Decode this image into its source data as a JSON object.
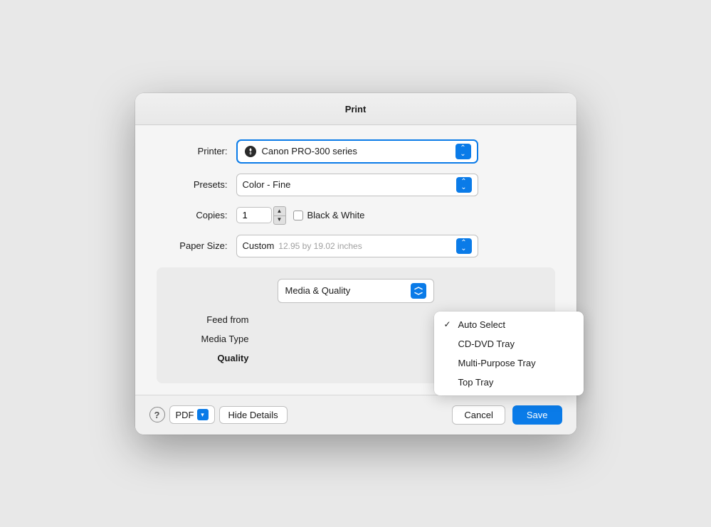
{
  "dialog": {
    "title": "Print"
  },
  "printer_row": {
    "label": "Printer:",
    "value": "Canon PRO-300 series"
  },
  "presets_row": {
    "label": "Presets:",
    "value": "Color - Fine"
  },
  "copies_row": {
    "label": "Copies:",
    "value": "1",
    "checkbox_label": "Black & White"
  },
  "paper_size_row": {
    "label": "Paper Size:",
    "value": "Custom",
    "dimensions": "12.95 by 19.02 inches"
  },
  "section": {
    "dropdown_label": "Media & Quality",
    "feed_label": "Feed from",
    "media_label": "Media Type",
    "quality_label": "Quality"
  },
  "dropdown_menu": {
    "items": [
      {
        "label": "Auto Select",
        "selected": true
      },
      {
        "label": "CD-DVD Tray",
        "selected": false
      },
      {
        "label": "Multi-Purpose Tray",
        "selected": false
      },
      {
        "label": "Top Tray",
        "selected": false
      }
    ]
  },
  "footer": {
    "help_label": "?",
    "pdf_label": "PDF",
    "hide_details_label": "Hide Details",
    "cancel_label": "Cancel",
    "save_label": "Save"
  }
}
